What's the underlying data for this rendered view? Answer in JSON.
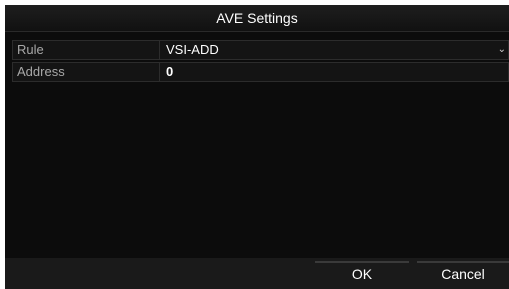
{
  "dialog": {
    "title": "AVE Settings"
  },
  "fields": {
    "rule": {
      "label": "Rule",
      "value": "VSI-ADD",
      "dropdown_icon": "chevron-down-icon"
    },
    "address": {
      "label": "Address",
      "value": "0"
    }
  },
  "buttons": {
    "ok_label": "OK",
    "cancel_label": "Cancel"
  },
  "colors": {
    "panel_background": "#0c0c0c",
    "label_text": "#a8a8a8",
    "value_text": "#ffffff"
  }
}
